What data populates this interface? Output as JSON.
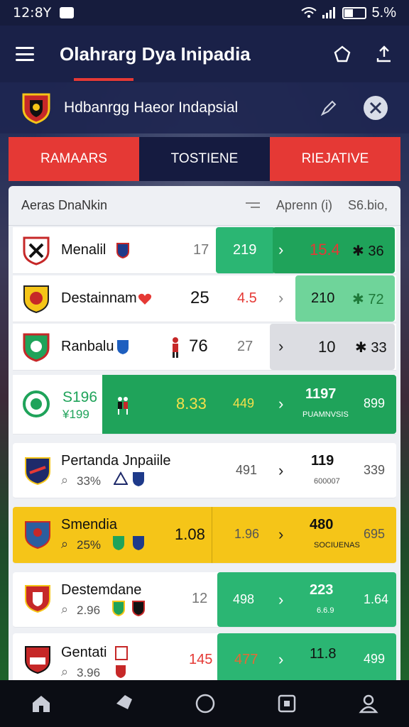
{
  "status": {
    "time": "12:8Y",
    "battery": "5.%"
  },
  "appbar": {
    "title": "Olahrarg  Dya Inipadia"
  },
  "club": {
    "title": "Hdbanrgg Haeor Indapsial"
  },
  "tabs": [
    {
      "label": "RAMAARS"
    },
    {
      "label": "TOSTIENE"
    },
    {
      "label": "RIEJATIVE"
    }
  ],
  "table": {
    "header_left": "Aeras DnaNkin",
    "header_mid": "Aprenn (i)",
    "header_right": "S6.bio,"
  },
  "rows": [
    {
      "name": "Menalil",
      "v1": "17",
      "v2": "219",
      "v3": "15.4",
      "v4": "✱ 36"
    },
    {
      "name": "Destainnam",
      "v1": "25",
      "v2": "4.5",
      "v3": "210",
      "v4": "✱ 72"
    },
    {
      "name": "Ranbalu",
      "v1": "76",
      "v2": "27",
      "v3": "10",
      "v4": "✱ 33"
    },
    {
      "name": "S196",
      "sub": "¥199",
      "v1": "8.33",
      "v2": "449",
      "v3": "1197",
      "v3sub": "PUAMNVSIS",
      "v4": "899"
    },
    {
      "name": "Pertanda Jnpaiile",
      "sub": "33%",
      "v1": "491",
      "v3": "119",
      "v3sub": "600007",
      "v4": "339"
    },
    {
      "name": "Smendia",
      "sub": "25%",
      "v1": "1.08",
      "v2": "1.96",
      "v3": "480",
      "v3sub": "SOCIUENAS",
      "v4": "695"
    },
    {
      "name": "Destemdane",
      "sub": "2.96",
      "v1": "12",
      "v2": "498",
      "v3": "223",
      "v3sub": "6.6.9",
      "v4": "1.64"
    },
    {
      "name": "Gentati",
      "sub": "3.96",
      "v1": "145",
      "v2": "477",
      "v3": "11.8",
      "v4": "499"
    }
  ],
  "colors": {
    "red": "#e53935",
    "navy": "#151b40",
    "green": "#2bb673",
    "darkgreen": "#1fa35a",
    "yellow": "#f5c518",
    "grey": "#dcdde2"
  },
  "icons": {
    "nav": [
      "home-icon",
      "tag-icon",
      "circle-icon",
      "square-icon",
      "profile-icon"
    ]
  }
}
